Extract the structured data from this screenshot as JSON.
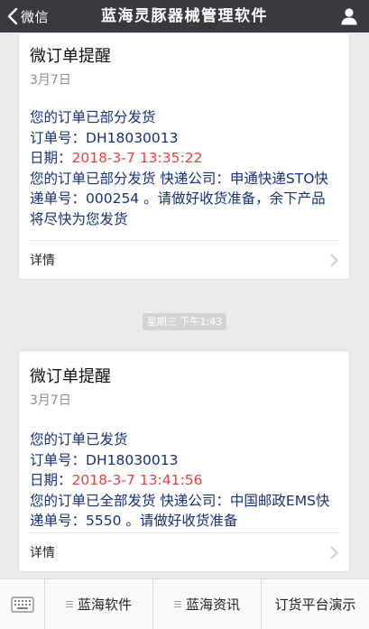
{
  "topbar": {
    "back_label": "微信",
    "title": "蓝海灵豚器械管理软件"
  },
  "messages": [
    {
      "title": "微订单提醒",
      "date": "3月7日",
      "status": "您的订单已部分发货",
      "order_label": "订单号：",
      "order_no": "DH18030013",
      "date_label": "日期：",
      "datetime": "2018-3-7 13:35:22",
      "detail": "您的订单已部分发货 快递公司：申通快递STO快递单号：000254 。请做好收货准备，余下产品将尽快为您发货",
      "details_label": "详情"
    },
    {
      "title": "微订单提醒",
      "date": "3月7日",
      "status": "您的订单已发货",
      "order_label": "订单号：",
      "order_no": "DH18030013",
      "date_label": "日期：",
      "datetime": "2018-3-7 13:41:56",
      "detail": "您的订单已全部发货 快递公司：中国邮政EMS快递单号：5550 。请做好收货准备",
      "details_label": "详情"
    }
  ],
  "timestamp": "星期三 下午1:43",
  "menu": {
    "items": [
      {
        "label": "蓝海软件"
      },
      {
        "label": "蓝海资讯"
      },
      {
        "label": "订货平台演示"
      }
    ]
  },
  "colors": {
    "nav_bg": "#393a3f",
    "content_text": "#173177",
    "datetime_red": "#e64340",
    "page_bg": "#ebebeb"
  }
}
